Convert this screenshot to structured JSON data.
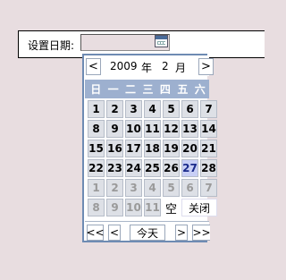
{
  "form": {
    "label": "设置日期:",
    "date_value": ""
  },
  "calendar_button": {
    "icon": "calendar-icon"
  },
  "picker": {
    "prev_month": "<",
    "next_month": ">",
    "year": "2009",
    "year_unit": "年",
    "month": "2",
    "month_unit": "月",
    "weekdays": [
      "日",
      "一",
      "二",
      "三",
      "四",
      "五",
      "六"
    ],
    "today_day": "27",
    "weeks": [
      [
        "1",
        "2",
        "3",
        "4",
        "5",
        "6",
        "7"
      ],
      [
        "8",
        "9",
        "10",
        "11",
        "12",
        "13",
        "14"
      ],
      [
        "15",
        "16",
        "17",
        "18",
        "19",
        "20",
        "21"
      ],
      [
        "22",
        "23",
        "24",
        "25",
        "26",
        "27",
        "28"
      ],
      [
        "1",
        "2",
        "3",
        "4",
        "5",
        "6",
        "7"
      ],
      [
        "8",
        "9",
        "10",
        "11"
      ]
    ],
    "clear_label": "空",
    "close_label": "关闭",
    "footer": {
      "prev_year": "<<",
      "prev_month": "<",
      "today": "今天",
      "next_month": ">",
      "next_year": ">>"
    }
  }
}
